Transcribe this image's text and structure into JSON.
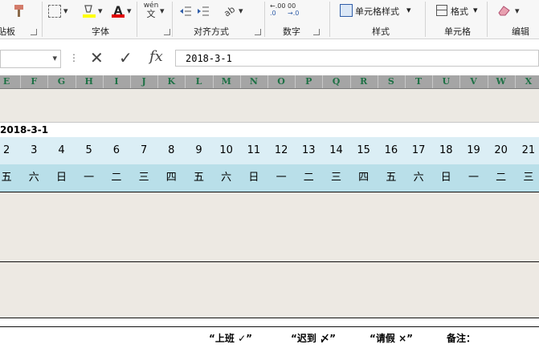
{
  "ribbon": {
    "clipboard_label": "粘贴板",
    "font_label": "字体",
    "font_color_letter": "A",
    "align_label": "对齐方式",
    "number_label": "数字",
    "styles_label": "样式",
    "cell_styles": "单元格样式",
    "cells_label": "单元格",
    "format_label": "格式",
    "edit_label": "编辑",
    "wen": "wén",
    "wen_char": "文",
    "increase_decimal": ".00",
    "decrease_decimal": "00",
    "brand_color": "#1e7145"
  },
  "formula_bar": {
    "fx_label": "fx",
    "value": "2018-3-1"
  },
  "columns": [
    "E",
    "F",
    "G",
    "H",
    "I",
    "J",
    "K",
    "L",
    "M",
    "N",
    "O",
    "P",
    "Q",
    "R",
    "S",
    "T",
    "U",
    "V",
    "W",
    "X"
  ],
  "sheet": {
    "date_cell": "2018-3-1",
    "day_numbers": [
      "2",
      "3",
      "4",
      "5",
      "6",
      "7",
      "8",
      "9",
      "10",
      "11",
      "12",
      "13",
      "14",
      "15",
      "16",
      "17",
      "18",
      "19",
      "20",
      "21"
    ],
    "weekdays": [
      "五",
      "六",
      "日",
      "一",
      "二",
      "三",
      "四",
      "五",
      "六",
      "日",
      "一",
      "二",
      "三",
      "四",
      "五",
      "六",
      "日",
      "一",
      "二",
      "三"
    ]
  },
  "footer": {
    "present": "“上班 ✓”",
    "late": "“迟到 〆”",
    "leave": "“请假 ×”",
    "remark": "备注："
  }
}
